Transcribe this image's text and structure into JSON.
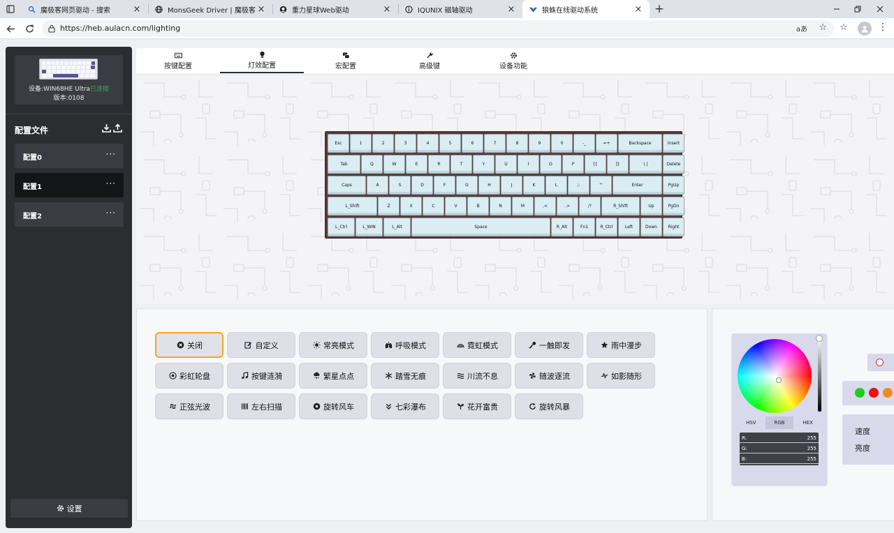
{
  "browser": {
    "tabs": [
      {
        "title": "魔极客网页驱动 - 搜索",
        "favicon": "search-icon"
      },
      {
        "title": "MonsGeek Driver | 魔极客云驱动",
        "favicon": "globe-icon"
      },
      {
        "title": "重力星球Web驱动",
        "favicon": "planet-icon"
      },
      {
        "title": "IQUNIX 磁轴驱动",
        "favicon": "info-icon"
      },
      {
        "title": "狼蛛在线驱动系统",
        "favicon": "spider-icon"
      }
    ],
    "active_tab": 4,
    "url": "https://heb.aulacn.com/lighting",
    "read_aloud_label": "aあ"
  },
  "sidebar": {
    "device_label": "设备:WIN68HE Ultra",
    "device_status": "已连接",
    "version": "版本:0108",
    "profiles_title": "配置文件",
    "profiles": [
      {
        "label": "配置0",
        "active": false
      },
      {
        "label": "配置1",
        "active": true
      },
      {
        "label": "配置2",
        "active": false
      }
    ],
    "more_label": "···",
    "settings_label": "设置"
  },
  "main_tabs": [
    {
      "label": "按键配置",
      "icon": "keyboard-icon"
    },
    {
      "label": "灯效配置",
      "icon": "bulb-icon"
    },
    {
      "label": "宏配置",
      "icon": "macro-icon"
    },
    {
      "label": "高级键",
      "icon": "wrench-icon"
    },
    {
      "label": "设备功能",
      "icon": "gear-icon"
    }
  ],
  "active_main_tab": 1,
  "keyboard": {
    "rows": [
      [
        "Esc",
        "1",
        "2",
        "3",
        "4",
        "5",
        "6",
        "7",
        "8",
        "9",
        "0",
        "-_",
        "=+",
        "Backspace",
        "Insert"
      ],
      [
        "Tab",
        "Q",
        "W",
        "E",
        "R",
        "T",
        "Y",
        "U",
        "I",
        "O",
        "P",
        "[{",
        "]}",
        "\\ |",
        "Delete"
      ],
      [
        "Caps",
        "A",
        "S",
        "D",
        "F",
        "G",
        "H",
        "J",
        "K",
        "L",
        ";:",
        "'\"",
        "Enter",
        "PgUp"
      ],
      [
        "L_Shift",
        "Z",
        "X",
        "C",
        "V",
        "B",
        "N",
        "M",
        ",<",
        ".>",
        "/?",
        "R_Shift",
        "Up",
        "PgDn"
      ],
      [
        "L_Ctrl",
        "L_WIN",
        "L_Alt",
        "Space",
        "R_Alt",
        "Fn1",
        "R_Ctrl",
        "Left",
        "Down",
        "Right"
      ]
    ],
    "key_color": "#d9edf2",
    "case_color": "#5a3e3e"
  },
  "effects": [
    {
      "label": "关闭",
      "icon": "close-circle-icon",
      "selected": true
    },
    {
      "label": "自定义",
      "icon": "edit-icon"
    },
    {
      "label": "常亮模式",
      "icon": "sun-icon"
    },
    {
      "label": "呼吸模式",
      "icon": "lungs-icon"
    },
    {
      "label": "霓虹模式",
      "icon": "rainbow-icon"
    },
    {
      "label": "一触即发",
      "icon": "key-icon"
    },
    {
      "label": "雨中漫步",
      "icon": "star-icon"
    },
    {
      "label": "彩虹轮盘",
      "icon": "target-icon"
    },
    {
      "label": "按键涟漪",
      "icon": "music-icon"
    },
    {
      "label": "繁星点点",
      "icon": "cloud-rain-icon"
    },
    {
      "label": "踏雪无痕",
      "icon": "snowflake-icon"
    },
    {
      "label": "川流不息",
      "icon": "waves-icon"
    },
    {
      "label": "随波逐流",
      "icon": "pinwheel-icon"
    },
    {
      "label": "如影随形",
      "icon": "pulse-icon"
    },
    {
      "label": "正弦光波",
      "icon": "square-wave-icon"
    },
    {
      "label": "左右扫描",
      "icon": "barcode-icon"
    },
    {
      "label": "旋转风车",
      "icon": "record-icon"
    },
    {
      "label": "七彩瀑布",
      "icon": "double-chevron-down-icon"
    },
    {
      "label": "花开富贵",
      "icon": "sprout-icon"
    },
    {
      "label": "旋转风暴",
      "icon": "rotate-icon"
    }
  ],
  "color": {
    "mode_tabs": [
      "HSV",
      "RGB",
      "HEX"
    ],
    "active_mode": 1,
    "rgb": [
      {
        "name": "R:",
        "value": "255"
      },
      {
        "name": "G:",
        "value": "255"
      },
      {
        "name": "B:",
        "value": "255"
      }
    ],
    "swatches": [
      "#22cc22",
      "#ee1111",
      "#f08a24"
    ],
    "speed_label": "速度",
    "brightness_label": "亮度"
  }
}
